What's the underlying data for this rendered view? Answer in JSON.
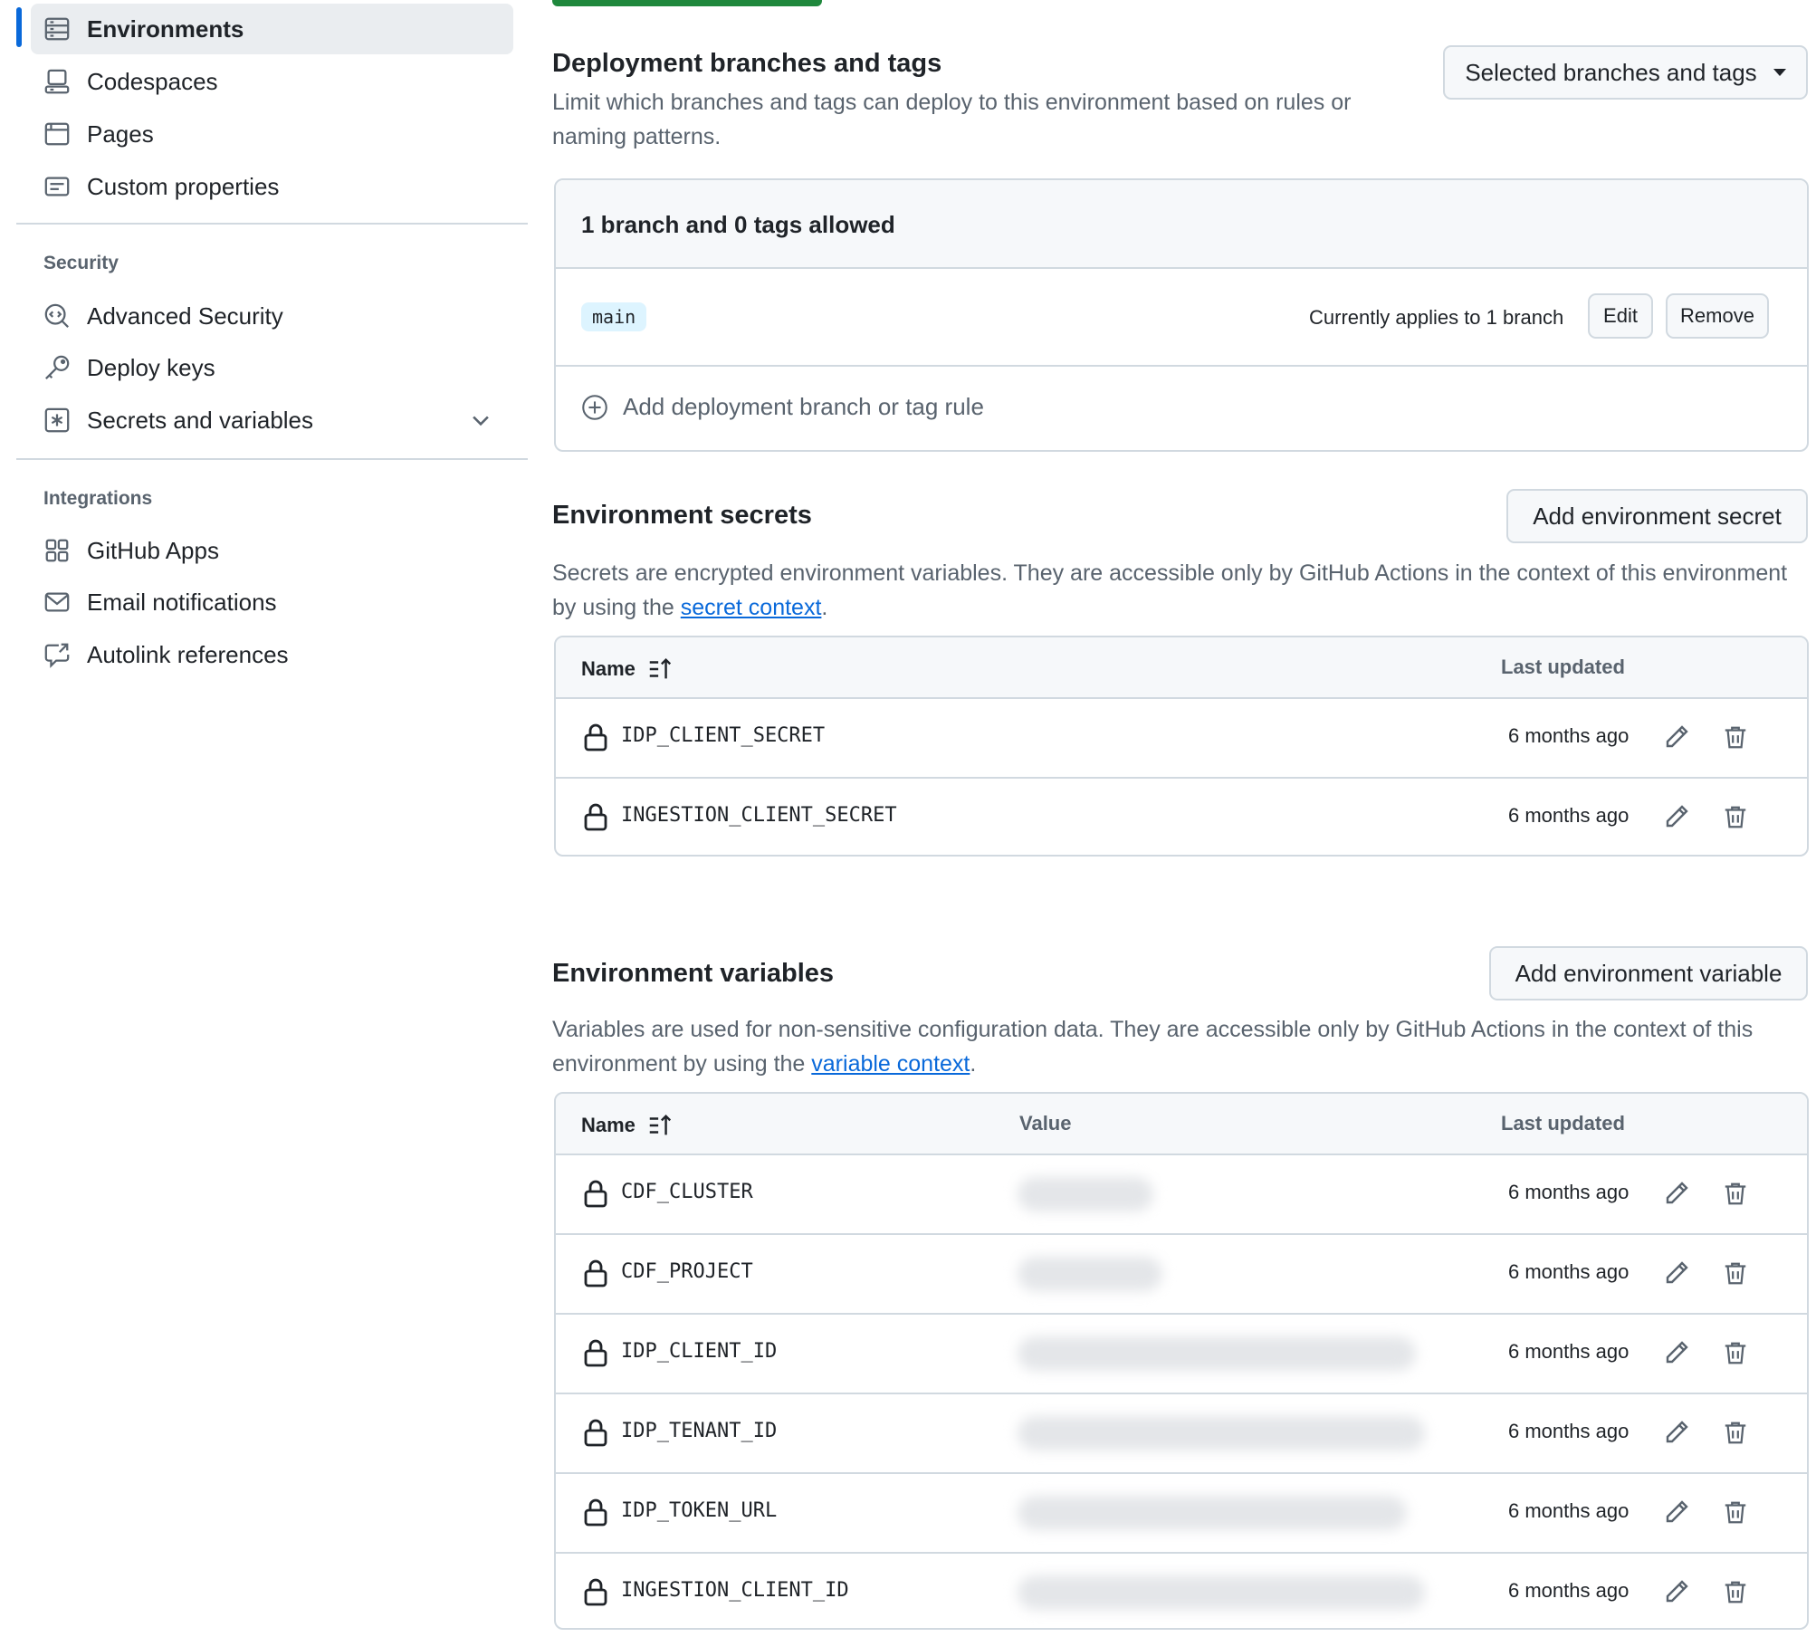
{
  "sidebar": {
    "items_top": [
      {
        "label": "Environments",
        "icon": "server-icon",
        "active": true
      },
      {
        "label": "Codespaces",
        "icon": "codespaces-icon"
      },
      {
        "label": "Pages",
        "icon": "browser-icon"
      },
      {
        "label": "Custom properties",
        "icon": "note-icon"
      }
    ],
    "security_title": "Security",
    "security_items": [
      {
        "label": "Advanced Security",
        "icon": "codescan-icon"
      },
      {
        "label": "Deploy keys",
        "icon": "key-icon"
      },
      {
        "label": "Secrets and variables",
        "icon": "key-asterisk-icon"
      }
    ],
    "integrations_title": "Integrations",
    "integrations_items": [
      {
        "label": "GitHub Apps",
        "icon": "apps-icon"
      },
      {
        "label": "Email notifications",
        "icon": "mail-icon"
      },
      {
        "label": "Autolink references",
        "icon": "cross-reference-icon"
      }
    ]
  },
  "deployment": {
    "title": "Deployment branches and tags",
    "description": "Limit which branches and tags can deploy to this environment based on rules or naming patterns.",
    "selector_label": "Selected branches and tags",
    "box_header": "1 branch and 0 tags allowed",
    "rule": {
      "branch": "main",
      "applies": "Currently applies to 1 branch",
      "edit": "Edit",
      "remove": "Remove"
    },
    "add_rule_label": "Add deployment branch or tag rule"
  },
  "secrets": {
    "title": "Environment secrets",
    "add_button": "Add environment secret",
    "desc_before": "Secrets are encrypted environment variables. They are accessible only by GitHub Actions in the context of this environment by using the ",
    "desc_link": "secret context",
    "desc_after": ".",
    "col_name": "Name",
    "col_updated": "Last updated",
    "rows": [
      {
        "name": "IDP_CLIENT_SECRET",
        "updated": "6 months ago"
      },
      {
        "name": "INGESTION_CLIENT_SECRET",
        "updated": "6 months ago"
      }
    ]
  },
  "variables": {
    "title": "Environment variables",
    "add_button": "Add environment variable",
    "desc_before": "Variables are used for non-sensitive configuration data. They are accessible only by GitHub Actions in the context of this environment by using the ",
    "desc_link": "variable context",
    "desc_after": ".",
    "col_name": "Name",
    "col_value": "Value",
    "col_updated": "Last updated",
    "rows": [
      {
        "name": "CDF_CLUSTER",
        "updated": "6 months ago"
      },
      {
        "name": "CDF_PROJECT",
        "updated": "6 months ago"
      },
      {
        "name": "IDP_CLIENT_ID",
        "updated": "6 months ago"
      },
      {
        "name": "IDP_TENANT_ID",
        "updated": "6 months ago"
      },
      {
        "name": "IDP_TOKEN_URL",
        "updated": "6 months ago"
      },
      {
        "name": "INGESTION_CLIENT_ID",
        "updated": "6 months ago"
      }
    ]
  }
}
